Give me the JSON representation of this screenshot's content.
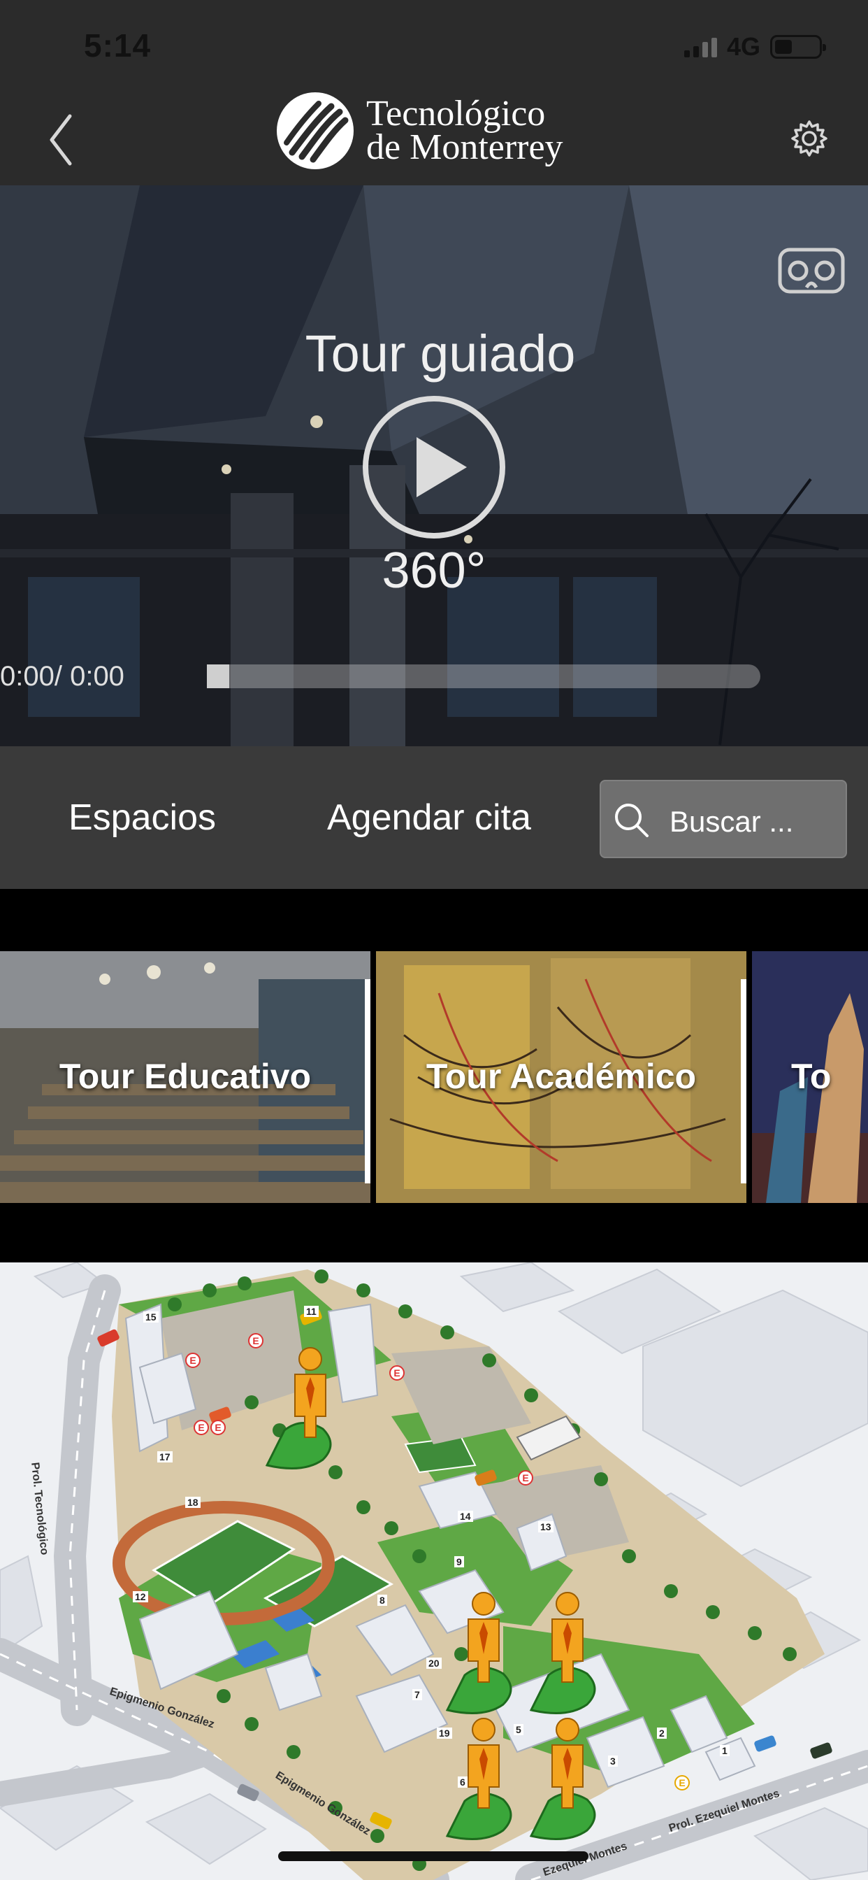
{
  "status_bar": {
    "time": "5:14",
    "network": "4G",
    "battery_level": 0.4
  },
  "nav": {
    "logo_line1": "Tecnológico",
    "logo_line2": "de Monterrey",
    "back_icon": "chevron-left-icon",
    "settings_icon": "gear-icon"
  },
  "hero": {
    "title": "Tour guiado",
    "mode_label": "360°",
    "time_readout": "0:00/ 0:00",
    "progress": 0,
    "vr_icon": "vr-headset-icon",
    "play_icon": "play-icon"
  },
  "actions": {
    "spaces": "Espacios",
    "appointment": "Agendar cita",
    "search_placeholder": "Buscar ...",
    "search_icon": "search-icon"
  },
  "tours": [
    {
      "label": "Tour Educativo"
    },
    {
      "label": "Tour Académico"
    },
    {
      "label": "To"
    }
  ],
  "map": {
    "streets": [
      "Prol. Tecnológico",
      "Epigmenio González",
      "Epigmenio González",
      "Prol. Ezequiel Montes",
      "Ezequiel Montes"
    ],
    "building_numbers": [
      "15",
      "11",
      "17",
      "18",
      "14",
      "13",
      "12",
      "9",
      "8",
      "20",
      "7",
      "19",
      "6",
      "5",
      "3",
      "2",
      "1"
    ],
    "marker_icon": "person-location-pin-icon"
  },
  "colors": {
    "nav_bg": "#2b2b2b",
    "action_bar_bg": "#3a3a3a",
    "search_bg": "#6f6f6f",
    "marker_orange": "#f3a41f",
    "marker_green": "#3aa63a"
  }
}
